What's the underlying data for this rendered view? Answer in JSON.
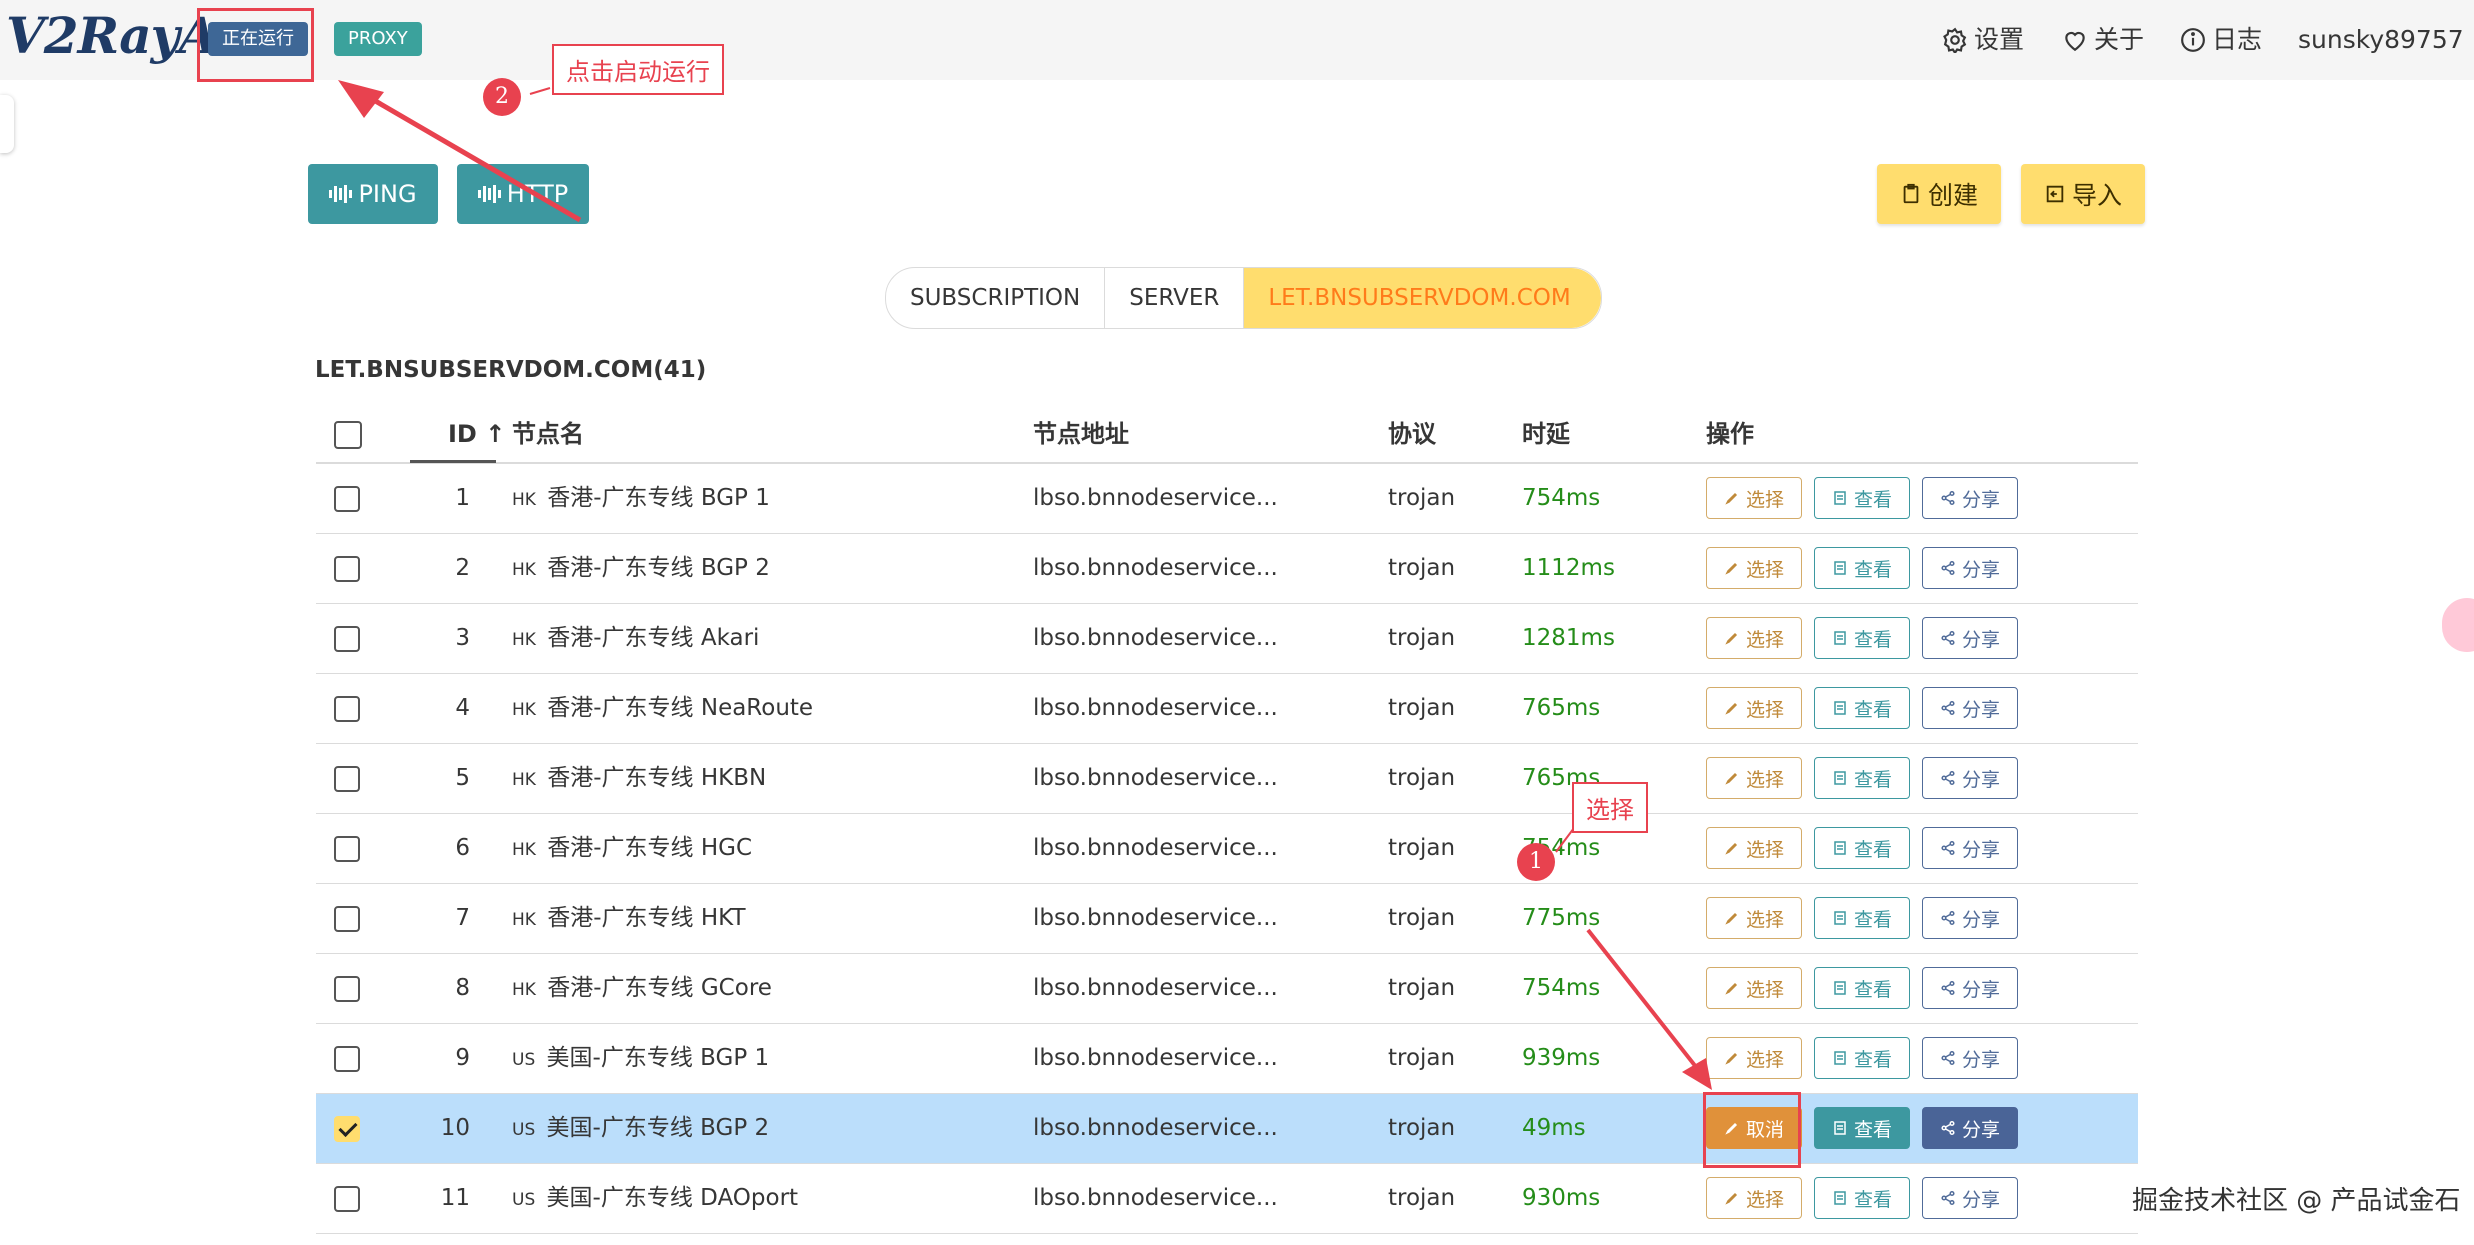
{
  "header": {
    "logo": "V2RayA",
    "status_tag": "正在运行",
    "mode_tag": "PROXY",
    "nav": {
      "settings": "设置",
      "about": "关于",
      "logs": "日志",
      "user": "sunsky89757"
    }
  },
  "toolbar": {
    "ping": "PING",
    "http": "HTTP",
    "create": "创建",
    "import": "导入"
  },
  "tabs": [
    "SUBSCRIPTION",
    "SERVER",
    "LET.BNSUBSERVDOM.COM"
  ],
  "group_title": "LET.BNSUBSERVDOM.COM(41)",
  "table": {
    "headers": {
      "id": "ID",
      "name": "节点名",
      "address": "节点地址",
      "protocol": "协议",
      "latency": "时延",
      "actions": "操作"
    },
    "rows": [
      {
        "id": "1",
        "flag": "HK",
        "name": "香港-广东专线 BGP 1",
        "address": "lbso.bnnodeservice...",
        "protocol": "trojan",
        "latency": "754ms",
        "checked": false
      },
      {
        "id": "2",
        "flag": "HK",
        "name": "香港-广东专线 BGP 2",
        "address": "lbso.bnnodeservice...",
        "protocol": "trojan",
        "latency": "1112ms",
        "checked": false
      },
      {
        "id": "3",
        "flag": "HK",
        "name": "香港-广东专线 Akari",
        "address": "lbso.bnnodeservice...",
        "protocol": "trojan",
        "latency": "1281ms",
        "checked": false
      },
      {
        "id": "4",
        "flag": "HK",
        "name": "香港-广东专线 NeaRoute",
        "address": "lbso.bnnodeservice...",
        "protocol": "trojan",
        "latency": "765ms",
        "checked": false
      },
      {
        "id": "5",
        "flag": "HK",
        "name": "香港-广东专线 HKBN",
        "address": "lbso.bnnodeservice...",
        "protocol": "trojan",
        "latency": "765ms",
        "checked": false
      },
      {
        "id": "6",
        "flag": "HK",
        "name": "香港-广东专线 HGC",
        "address": "lbso.bnnodeservice...",
        "protocol": "trojan",
        "latency": "754ms",
        "checked": false
      },
      {
        "id": "7",
        "flag": "HK",
        "name": "香港-广东专线 HKT",
        "address": "lbso.bnnodeservice...",
        "protocol": "trojan",
        "latency": "775ms",
        "checked": false
      },
      {
        "id": "8",
        "flag": "HK",
        "name": "香港-广东专线 GCore",
        "address": "lbso.bnnodeservice...",
        "protocol": "trojan",
        "latency": "754ms",
        "checked": false
      },
      {
        "id": "9",
        "flag": "US",
        "name": "美国-广东专线 BGP 1",
        "address": "lbso.bnnodeservice...",
        "protocol": "trojan",
        "latency": "939ms",
        "checked": false
      },
      {
        "id": "10",
        "flag": "US",
        "name": "美国-广东专线 BGP 2",
        "address": "lbso.bnnodeservice...",
        "protocol": "trojan",
        "latency": "49ms",
        "checked": true
      },
      {
        "id": "11",
        "flag": "US",
        "name": "美国-广东专线 DAOport",
        "address": "lbso.bnnodeservice...",
        "protocol": "trojan",
        "latency": "930ms",
        "checked": false
      }
    ],
    "actions": {
      "select": "选择",
      "cancel": "取消",
      "view": "查看",
      "share": "分享"
    }
  },
  "annotations": {
    "label_1": "选择",
    "num_1": "1",
    "label_2": "点击启动运行",
    "num_2": "2"
  },
  "watermark": "掘金技术社区 @ 产品试金石",
  "colors": {
    "primary": "#3d98a0",
    "warning": "#ffdd6e",
    "latency": "#258d19",
    "annotation": "#e8424f",
    "selected_row": "#bbdefb"
  }
}
